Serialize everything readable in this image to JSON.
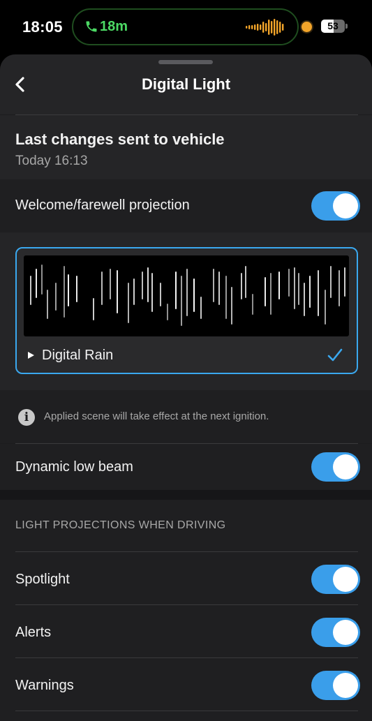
{
  "status_bar": {
    "time": "18:05",
    "call_duration": "18m",
    "battery_level": "53",
    "battery_fraction": 0.53,
    "call_icon": "phone-icon",
    "recording_indicator_color": "#f3a52a"
  },
  "nav": {
    "title": "Digital Light",
    "back_icon": "chevron-left-icon"
  },
  "last_changes": {
    "title": "Last changes sent to vehicle",
    "timestamp": "Today 16:13"
  },
  "welcome_projection": {
    "label": "Welcome/farewell projection",
    "enabled": true
  },
  "scene": {
    "name": "Digital Rain",
    "selected": true,
    "accent_color": "#3aa8ef"
  },
  "info": {
    "text": "Applied scene will take effect at the next ignition."
  },
  "dynamic_low_beam": {
    "label": "Dynamic low beam",
    "enabled": true
  },
  "driving_projections": {
    "header": "LIGHT PROJECTIONS WHEN DRIVING",
    "items": [
      {
        "label": "Spotlight",
        "enabled": true
      },
      {
        "label": "Alerts",
        "enabled": true
      },
      {
        "label": "Warnings",
        "enabled": true
      }
    ]
  },
  "colors": {
    "toggle_on": "#3a9eea",
    "sheet_background": "#1c1c1e"
  }
}
